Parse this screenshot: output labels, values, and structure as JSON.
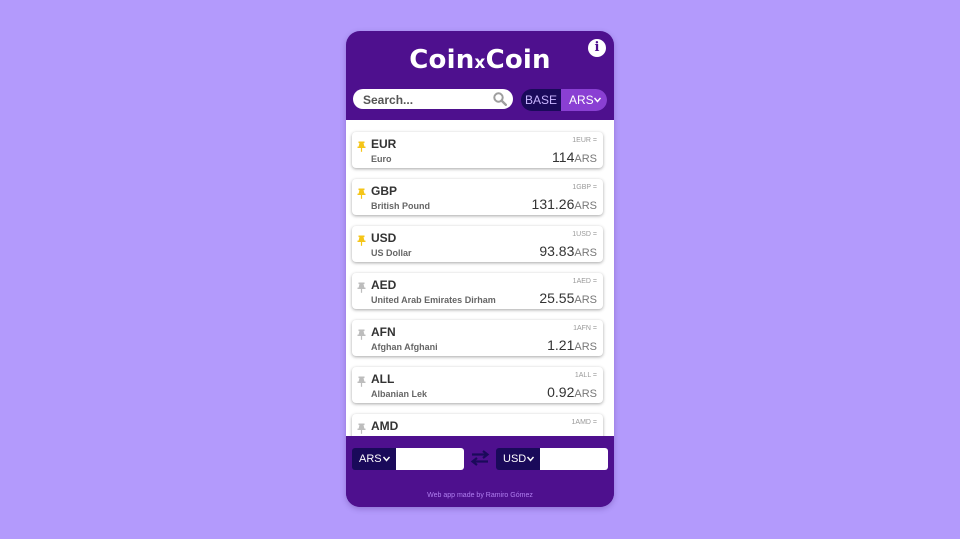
{
  "app": {
    "title_prefix": "Coin",
    "title_x": "x",
    "title_suffix": "Coin",
    "info_glyph": "i"
  },
  "search": {
    "placeholder": "Search..."
  },
  "base": {
    "label": "BASE",
    "value": "ARS"
  },
  "currencies": [
    {
      "code": "EUR",
      "name": "Euro",
      "unit": "1EUR =",
      "rate": "114",
      "ccy": "ARS",
      "pinned": true
    },
    {
      "code": "GBP",
      "name": "British Pound",
      "unit": "1GBP =",
      "rate": "131.26",
      "ccy": "ARS",
      "pinned": true
    },
    {
      "code": "USD",
      "name": "US Dollar",
      "unit": "1USD =",
      "rate": "93.83",
      "ccy": "ARS",
      "pinned": true
    },
    {
      "code": "AED",
      "name": "United Arab Emirates Dirham",
      "unit": "1AED =",
      "rate": "25.55",
      "ccy": "ARS",
      "pinned": false
    },
    {
      "code": "AFN",
      "name": "Afghan Afghani",
      "unit": "1AFN =",
      "rate": "1.21",
      "ccy": "ARS",
      "pinned": false
    },
    {
      "code": "ALL",
      "name": "Albanian Lek",
      "unit": "1ALL =",
      "rate": "0.92",
      "ccy": "ARS",
      "pinned": false
    },
    {
      "code": "AMD",
      "name": "",
      "unit": "1AMD =",
      "rate": "",
      "ccy": "",
      "pinned": false
    }
  ],
  "converter": {
    "from": "ARS",
    "from_value": "",
    "to": "USD",
    "to_value": ""
  },
  "footer": {
    "credit": "Web app made by Ramiro Gómez"
  },
  "colors": {
    "background": "#b39afc",
    "app_purple": "#4e108e",
    "dark_navy": "#1a0a5a",
    "accent_violet": "#8a3fd3",
    "pin_pinned": "#f5c518",
    "pin_unpinned": "#bdbdbd"
  },
  "icons": {
    "info": "info-icon",
    "search": "search-icon",
    "chevron": "chevron-down-icon",
    "pin": "pin-icon",
    "swap": "swap-icon"
  }
}
